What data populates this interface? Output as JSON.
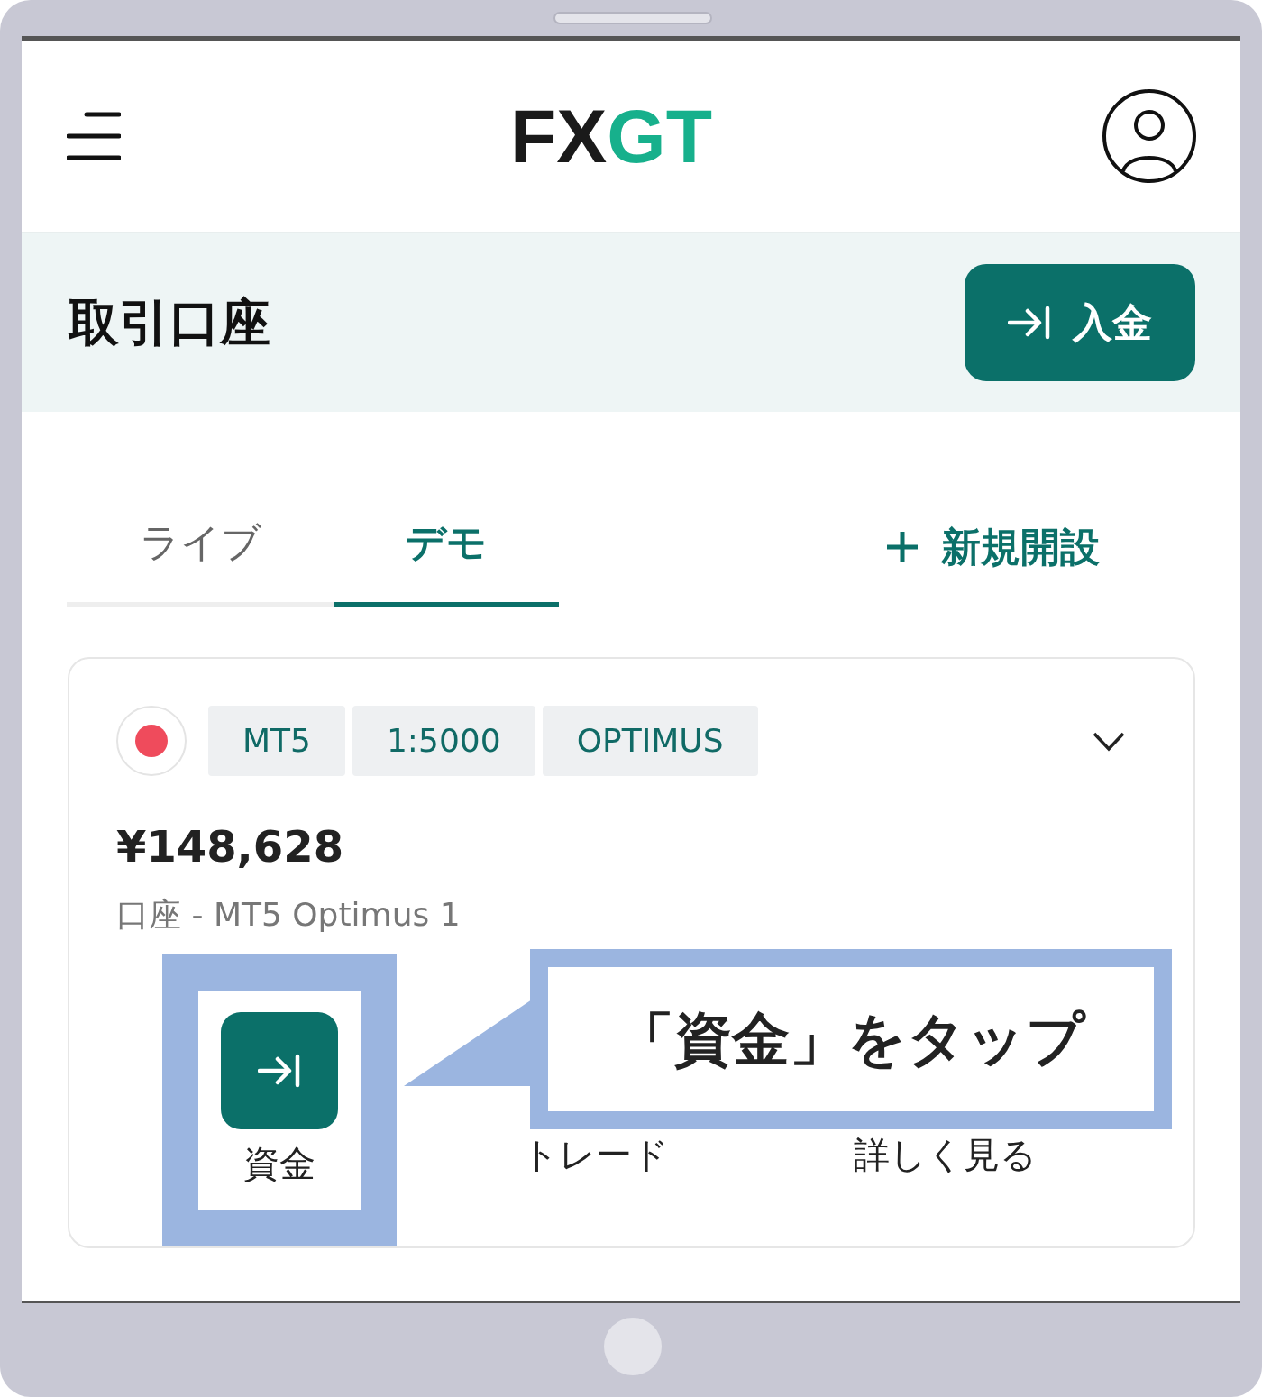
{
  "header": {
    "logo": [
      {
        "text": "FX",
        "kind": "dark"
      },
      {
        "text": "GT",
        "kind": "accent"
      }
    ]
  },
  "section": {
    "title": "取引口座",
    "deposit_button": "入金"
  },
  "tabs": [
    {
      "label": "ライブ",
      "selected": false
    },
    {
      "label": "デモ",
      "selected": true
    }
  ],
  "new_account": "新規開設",
  "account": {
    "expanded": false,
    "tags": [
      "MT5",
      "1:5000",
      "OPTIMUS"
    ],
    "balance": "¥148,628",
    "name": "口座 - MT5 Optimus 1",
    "actions": [
      {
        "label": "資金",
        "highlighted": true
      },
      {
        "label": "トレード",
        "highlighted": false
      },
      {
        "label": "詳しく見る",
        "highlighted": false
      }
    ]
  },
  "callout": {
    "text": "「資金」をタップ"
  }
}
